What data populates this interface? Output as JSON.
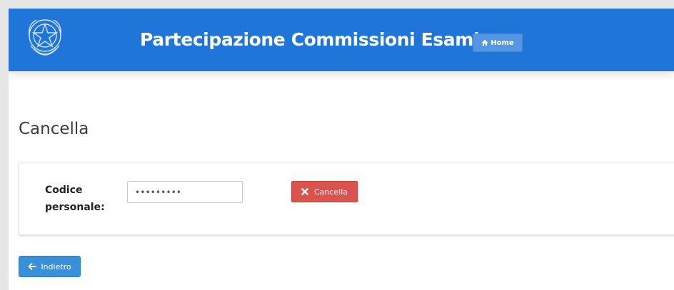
{
  "header": {
    "title": "Partecipazione Commissioni Esami",
    "home_label": "Home",
    "emblem_icon": "repubblica-italiana-emblem",
    "home_icon": "home-icon",
    "background_color": "#2076d8"
  },
  "main": {
    "title": "Cancella",
    "form": {
      "label": "Codice personale:",
      "value": "•••••••••",
      "delete_label": "Cancella",
      "delete_icon": "close-icon",
      "delete_color": "#d9534f"
    },
    "back_label": "Indietro",
    "back_icon": "arrow-left-icon",
    "back_color": "#3a8fd9"
  }
}
